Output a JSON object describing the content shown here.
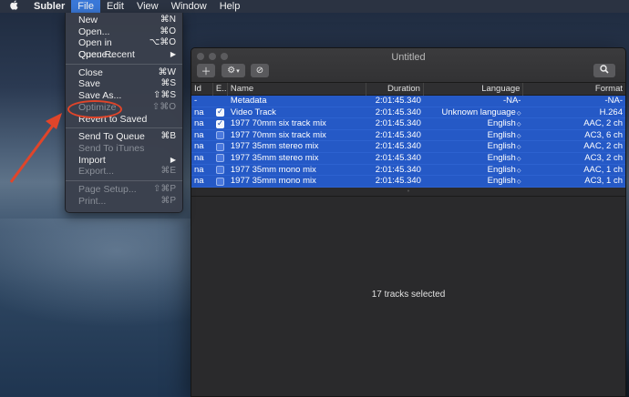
{
  "menubar": {
    "apple_icon": "apple-icon",
    "app_name": "Subler",
    "items": [
      "File",
      "Edit",
      "View",
      "Window",
      "Help"
    ]
  },
  "file_menu": {
    "items": [
      {
        "label": "New",
        "shortcut": "⌘N",
        "enabled": true
      },
      {
        "label": "Open...",
        "shortcut": "⌘O",
        "enabled": true
      },
      {
        "label": "Open in Queue...",
        "shortcut": "⌥⌘O",
        "enabled": true
      },
      {
        "label": "Open Recent",
        "shortcut": "▶",
        "enabled": true
      },
      {
        "label": "Close",
        "shortcut": "⌘W",
        "enabled": true
      },
      {
        "label": "Save",
        "shortcut": "⌘S",
        "enabled": true
      },
      {
        "label": "Save As...",
        "shortcut": "⇧⌘S",
        "enabled": true
      },
      {
        "label": "Optimize",
        "shortcut": "⇧⌘O",
        "enabled": false
      },
      {
        "label": "Revert to Saved",
        "shortcut": "",
        "enabled": true
      },
      {
        "label": "Send To Queue",
        "shortcut": "⌘B",
        "enabled": true
      },
      {
        "label": "Send To iTunes",
        "shortcut": "",
        "enabled": false
      },
      {
        "label": "Import",
        "shortcut": "▶",
        "enabled": true
      },
      {
        "label": "Export...",
        "shortcut": "⌘E",
        "enabled": false
      },
      {
        "label": "Page Setup...",
        "shortcut": "⇧⌘P",
        "enabled": false
      },
      {
        "label": "Print...",
        "shortcut": "⌘P",
        "enabled": false
      }
    ]
  },
  "window": {
    "title": "Untitled",
    "toolbar": {
      "add_icon": "plus-icon",
      "gear_icon": "gear-icon",
      "chevron_icon": "chevron-down-icon",
      "remove_icon": "prohibit-icon",
      "search_icon": "search-icon"
    },
    "columns": {
      "id": "Id",
      "enabled": "E...",
      "name": "Name",
      "duration": "Duration",
      "language": "Language",
      "format": "Format"
    },
    "tracks": [
      {
        "id": "-",
        "enabled": null,
        "name": "Metadata",
        "duration": "2:01:45.340",
        "language": "-NA-",
        "format": "-NA-"
      },
      {
        "id": "na",
        "enabled": true,
        "name": "Video Track",
        "duration": "2:01:45.340",
        "language": "Unknown language",
        "format": "H.264"
      },
      {
        "id": "na",
        "enabled": true,
        "name": "1977 70mm six track mix",
        "duration": "2:01:45.340",
        "language": "English",
        "format": "AAC, 2 ch"
      },
      {
        "id": "na",
        "enabled": false,
        "name": "1977 70mm six track mix",
        "duration": "2:01:45.340",
        "language": "English",
        "format": "AC3, 6 ch"
      },
      {
        "id": "na",
        "enabled": false,
        "name": "1977 35mm stereo mix",
        "duration": "2:01:45.340",
        "language": "English",
        "format": "AAC, 2 ch"
      },
      {
        "id": "na",
        "enabled": false,
        "name": "1977 35mm stereo mix",
        "duration": "2:01:45.340",
        "language": "English",
        "format": "AC3, 2 ch"
      },
      {
        "id": "na",
        "enabled": false,
        "name": "1977 35mm mono mix",
        "duration": "2:01:45.340",
        "language": "English",
        "format": "AAC, 1 ch"
      },
      {
        "id": "na",
        "enabled": false,
        "name": "1977 35mm mono mix",
        "duration": "2:01:45.340",
        "language": "English",
        "format": "AC3, 1 ch"
      }
    ],
    "status": "17 tracks selected"
  },
  "colors": {
    "selection": "#2559c6",
    "menu_highlight": "#3a78d8",
    "annotation": "#e0452a"
  }
}
